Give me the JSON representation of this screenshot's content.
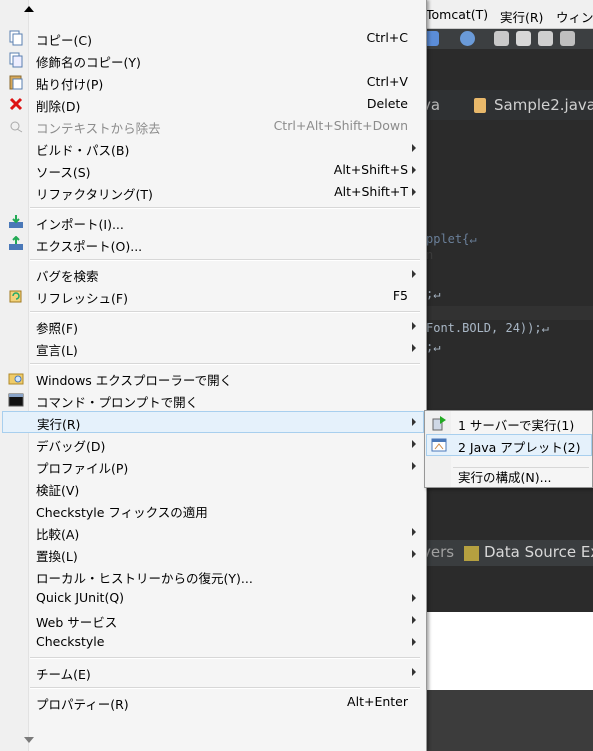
{
  "background": {
    "menubar": [
      "Tomcat(T)",
      "実行(R)",
      "ウィン"
    ],
    "editor_tabs": [
      "va",
      "Sample2.java"
    ],
    "code_lines": [
      "pplet{↵",
      "n",
      ";↵",
      "Font.BOLD, 24));↵",
      ";↵"
    ],
    "views": [
      "vers",
      "Data Source Ex"
    ]
  },
  "menu": {
    "items": [
      {
        "label": "コピー(C)",
        "shortcut": "Ctrl+C",
        "icon": "copy-icon"
      },
      {
        "label": "修飾名のコピー(Y)",
        "shortcut": "",
        "icon": "copy-qualified-icon"
      },
      {
        "label": "貼り付け(P)",
        "shortcut": "Ctrl+V",
        "icon": "paste-icon"
      },
      {
        "label": "削除(D)",
        "shortcut": "Delete",
        "icon": "delete-icon"
      },
      {
        "label": "コンテキストから除去",
        "shortcut": "Ctrl+Alt+Shift+Down",
        "icon": "remove-context-icon",
        "disabled": true
      },
      {
        "label": "ビルド・パス(B)",
        "shortcut": "",
        "submenu": true
      },
      {
        "label": "ソース(S)",
        "shortcut": "Alt+Shift+S",
        "submenu": true
      },
      {
        "label": "リファクタリング(T)",
        "shortcut": "Alt+Shift+T",
        "submenu": true
      },
      {
        "label": "インポート(I)...",
        "shortcut": "",
        "icon": "import-icon"
      },
      {
        "label": "エクスポート(O)...",
        "shortcut": "",
        "icon": "export-icon"
      },
      {
        "label": "バグを検索",
        "shortcut": "",
        "submenu": true
      },
      {
        "label": "リフレッシュ(F)",
        "shortcut": "F5",
        "icon": "refresh-icon"
      },
      {
        "label": "参照(F)",
        "shortcut": "",
        "submenu": true
      },
      {
        "label": "宣言(L)",
        "shortcut": "",
        "submenu": true
      },
      {
        "label": "Windows エクスプローラーで開く",
        "shortcut": "",
        "icon": "explorer-icon"
      },
      {
        "label": "コマンド・プロンプトで開く",
        "shortcut": "",
        "icon": "command-prompt-icon"
      },
      {
        "label": "実行(R)",
        "shortcut": "",
        "submenu": true,
        "highlighted": true
      },
      {
        "label": "デバッグ(D)",
        "shortcut": "",
        "submenu": true
      },
      {
        "label": "プロファイル(P)",
        "shortcut": "",
        "submenu": true
      },
      {
        "label": "検証(V)",
        "shortcut": ""
      },
      {
        "label": "Checkstyle フィックスの適用",
        "shortcut": ""
      },
      {
        "label": "比較(A)",
        "shortcut": "",
        "submenu": true
      },
      {
        "label": "置換(L)",
        "shortcut": "",
        "submenu": true
      },
      {
        "label": "ローカル・ヒストリーからの復元(Y)...",
        "shortcut": ""
      },
      {
        "label": "Quick JUnit(Q)",
        "shortcut": "",
        "submenu": true
      },
      {
        "label": "Web サービス",
        "shortcut": "",
        "submenu": true
      },
      {
        "label": "Checkstyle",
        "shortcut": "",
        "submenu": true
      },
      {
        "label": "チーム(E)",
        "shortcut": "",
        "submenu": true
      },
      {
        "label": "プロパティー(R)",
        "shortcut": "Alt+Enter"
      }
    ]
  },
  "submenu": {
    "items": [
      {
        "label": "1 サーバーで実行(1)",
        "icon": "run-on-server-icon"
      },
      {
        "label": "2 Java アプレット(2)",
        "icon": "java-applet-icon",
        "highlighted": true
      },
      {
        "label": "実行の構成(N)...",
        "icon": ""
      }
    ]
  }
}
